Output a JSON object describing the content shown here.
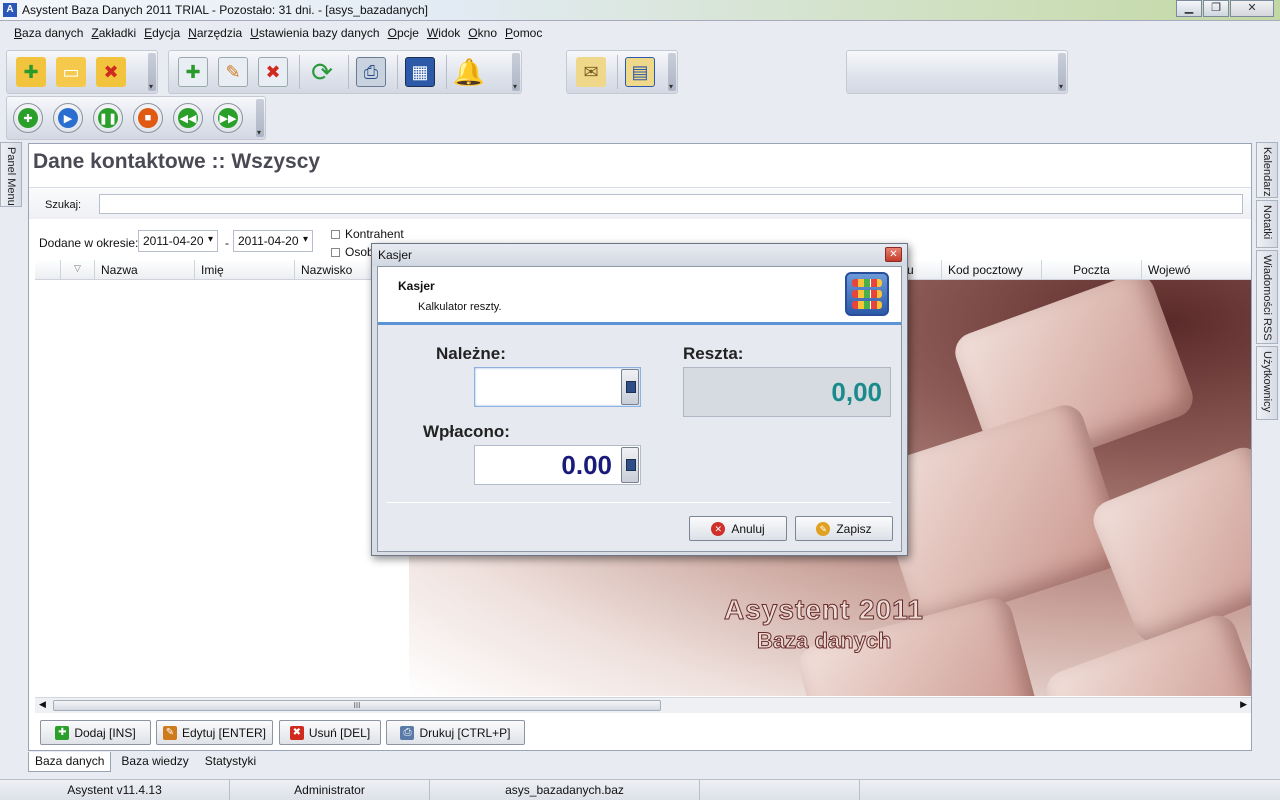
{
  "window": {
    "title": "Asystent Baza Danych 2011 TRIAL - Pozostało: 31 dni. - [asys_bazadanych]",
    "controls": [
      "minimize",
      "maximize",
      "close"
    ]
  },
  "menu": [
    "Baza danych",
    "Zakładki",
    "Edycja",
    "Narzędzia",
    "Ustawienia bazy danych",
    "Opcje",
    "Widok",
    "Okno",
    "Pomoc"
  ],
  "side_panels": {
    "left": "Panel Menu",
    "right": [
      "Kalendarz",
      "Notatki",
      "Wiadomości RSS",
      "Użytkownicy"
    ]
  },
  "content": {
    "heading": "Dane kontaktowe :: Wszyscy",
    "search_label": "Szukaj:",
    "search_value": "",
    "filter_label": "Dodane w okresie:",
    "date_from": "2011-04-20",
    "date_sep": "-",
    "date_to": "2011-04-20",
    "cb_kontrahent": "Kontrahent",
    "cb_osoba": "Osob",
    "columns": [
      "Nazwa",
      "Imię",
      "Nazwisko",
      "r budynku",
      "Kod pocztowy",
      "Poczta",
      "Wojewó"
    ],
    "brand_line1": "Asystent 2011",
    "brand_line2": "Baza danych",
    "scroll_glyph": "III"
  },
  "actions": {
    "add": "Dodaj [INS]",
    "edit": "Edytuj [ENTER]",
    "delete": "Usuń [DEL]",
    "print": "Drukuj [CTRL+P]"
  },
  "tabs": [
    "Baza danych",
    "Baza wiedzy",
    "Statystyki"
  ],
  "status": [
    "Asystent v11.4.13",
    "Administrator",
    "asys_bazadanych.baz"
  ],
  "dialog": {
    "title": "Kasjer",
    "header_title": "Kasjer",
    "header_sub": "Kalkulator reszty.",
    "due_label": "Należne:",
    "due_value": "",
    "change_label": "Reszta:",
    "change_value": "0,00",
    "paid_label": "Wpłacono:",
    "paid_value": "0.00",
    "cancel": "Anuluj",
    "save": "Zapisz"
  },
  "colors": {
    "accent": "#5a94d6",
    "change_value": "#1b8a8a",
    "paid_value": "#1a1a7a"
  }
}
